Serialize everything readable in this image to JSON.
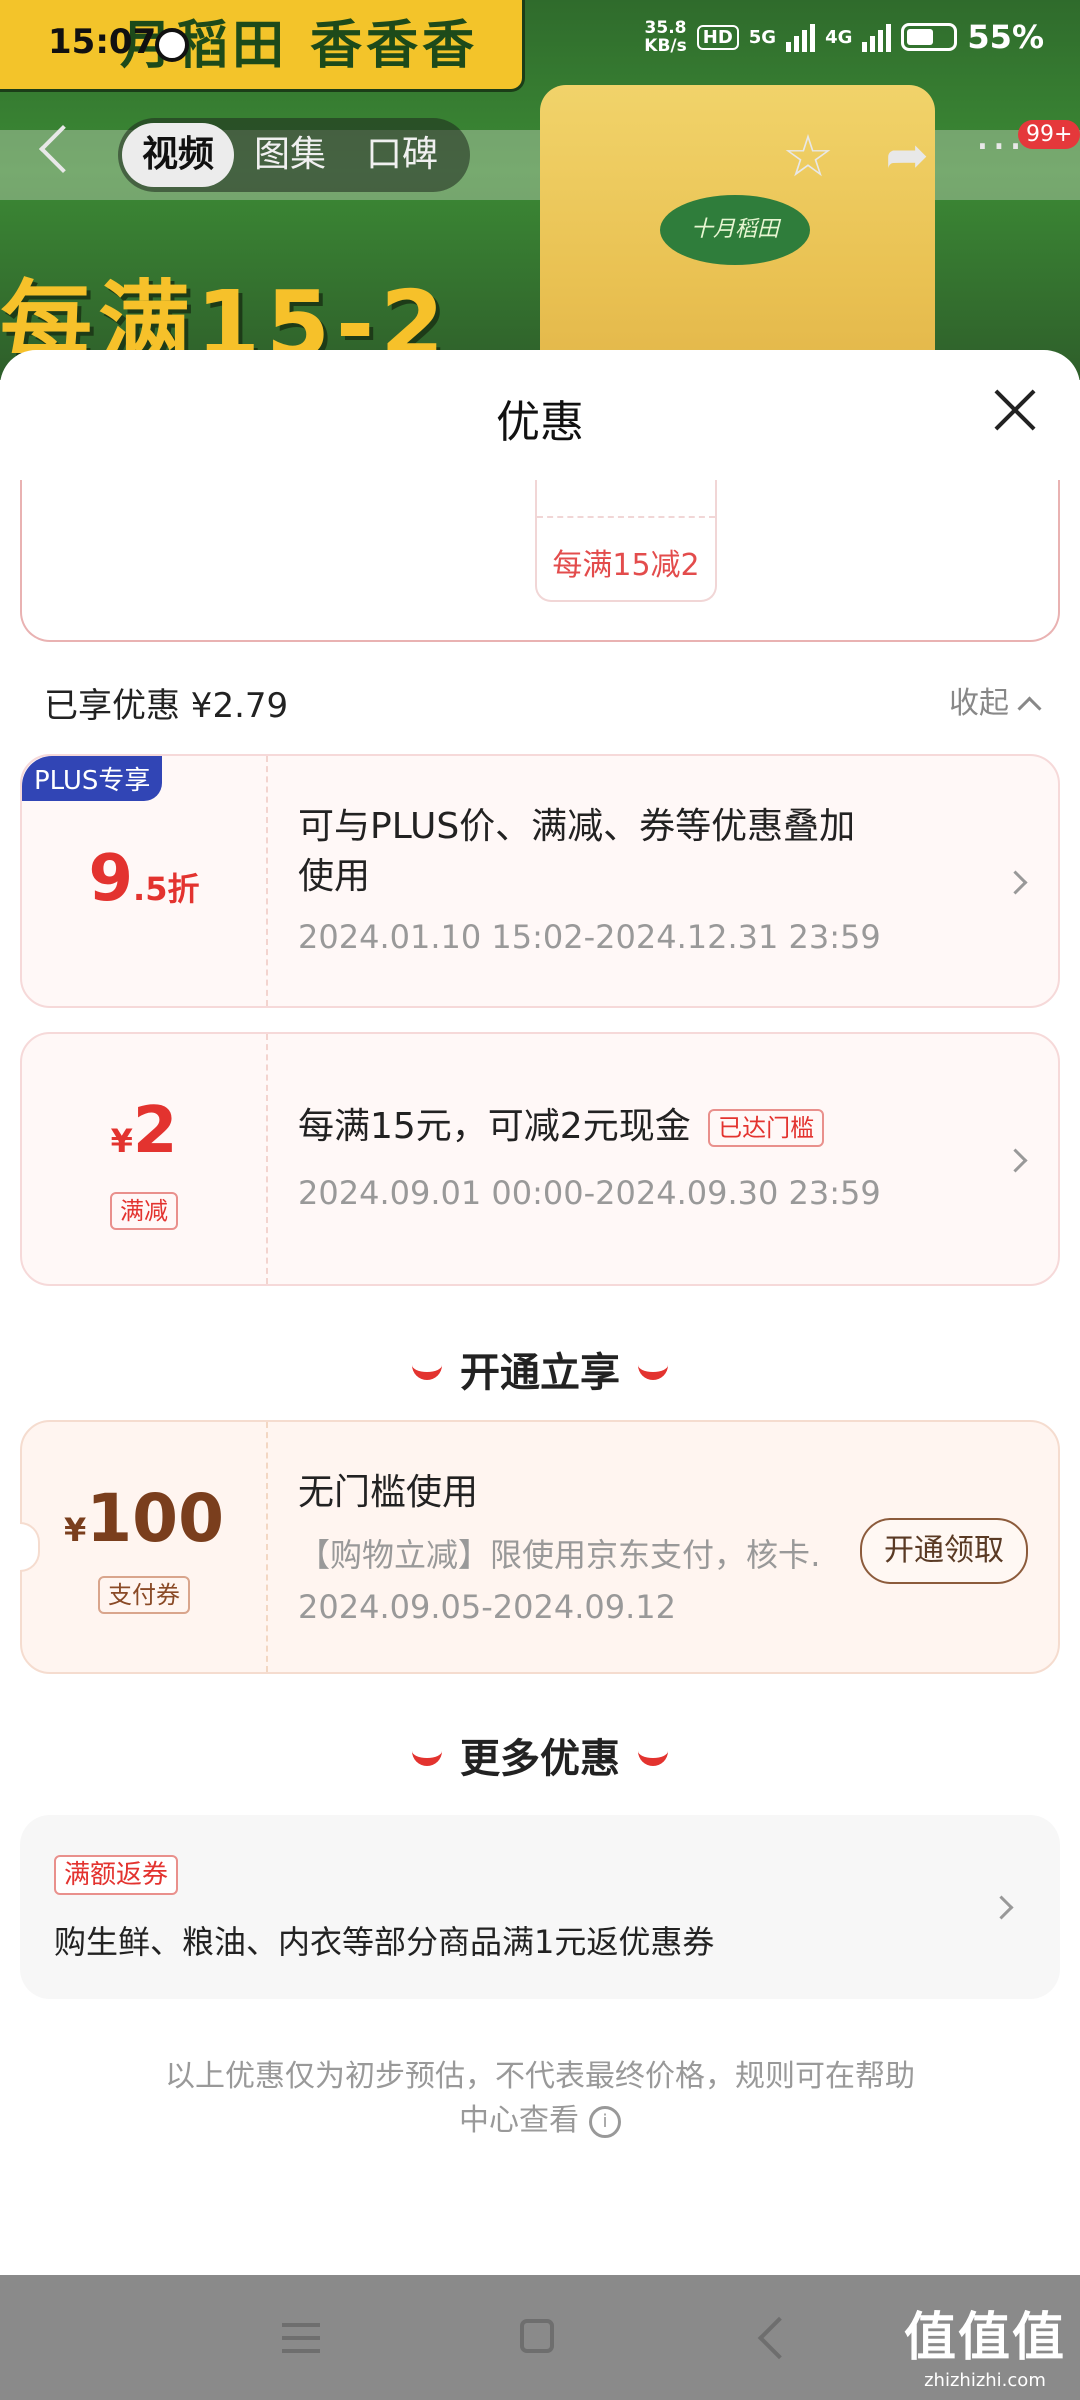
{
  "status_bar": {
    "time": "15:07",
    "net_speed_value": "35.8",
    "net_speed_unit": "KB/s",
    "hd_label": "HD",
    "gen1": "5G",
    "gen2": "4G",
    "battery": "55%"
  },
  "hero": {
    "banner_text": "月稻田 香香香",
    "slogan": "每满15-2",
    "bag_logo": "十月稻田"
  },
  "nav": {
    "tabs": [
      "视频",
      "图集",
      "口碑"
    ],
    "badge": "99+"
  },
  "sheet": {
    "title": "优惠",
    "top_card_tile_label": "每满15减2",
    "enjoyed": "已享优惠 ¥2.79",
    "collapse": "收起"
  },
  "coupons": [
    {
      "tag": "PLUS专享",
      "value_main": "9",
      "value_suffix": ".5折",
      "desc_line1": "可与PLUS价、满减、券等优惠叠加",
      "desc_line2": "使用",
      "date": "2024.01.10 15:02-2024.12.31 23:59"
    },
    {
      "yen": "¥",
      "value_main": "2",
      "type_tag": "满减",
      "desc": "每满15元，可减2元现金",
      "threshold_tag": "已达门槛",
      "date": "2024.09.01 00:00-2024.09.30 23:59"
    }
  ],
  "section_open": "开通立享",
  "vip_coupon": {
    "yen": "¥",
    "value_main": "100",
    "type_tag": "支付券",
    "title": "无门槛使用",
    "desc": "【购物立减】限使用京东支付，核卡…",
    "date": "2024.09.05-2024.09.12",
    "button": "开通领取"
  },
  "section_more": "更多优惠",
  "more_card": {
    "tag": "满额返券",
    "text": "购生鲜、粮油、内衣等部分商品满1元返优惠券"
  },
  "footnote": {
    "line1": "以上优惠仅为初步预估，不代表最终价格，规则可在帮助",
    "line2": "中心查看"
  },
  "watermark": {
    "main": "值值值",
    "sub": "zhizhizhi.com"
  },
  "colors": {
    "accent_red": "#e3332f",
    "plus_blue": "#3145b5"
  }
}
